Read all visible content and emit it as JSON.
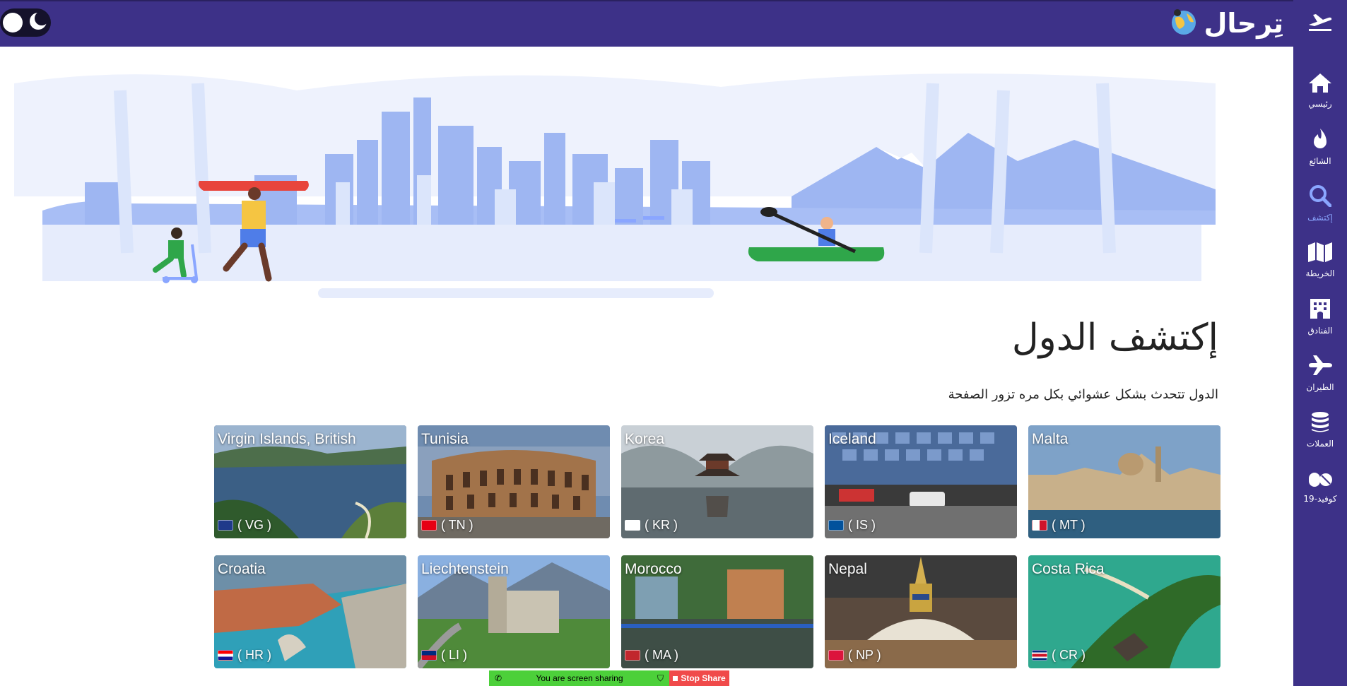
{
  "app": {
    "brand": "تِرحال"
  },
  "theme_toggle": {
    "state": "dark-mode toggle"
  },
  "sidebar": {
    "items": [
      {
        "label": "رئيسي",
        "icon": "home-icon"
      },
      {
        "label": "الشائع",
        "icon": "fire-icon"
      },
      {
        "label": "إكتشف",
        "icon": "search-icon",
        "active": true
      },
      {
        "label": "الخريطة",
        "icon": "map-icon"
      },
      {
        "label": "الفنادق",
        "icon": "hotel-icon"
      },
      {
        "label": "الطيران",
        "icon": "plane-icon"
      },
      {
        "label": "العملات",
        "icon": "coins-icon"
      },
      {
        "label": "كوفيد-19",
        "icon": "pills-icon"
      }
    ]
  },
  "main": {
    "title": "إكتشف الدول",
    "subtitle": "الدول تتحدث بشكل عشوائي بكل مره تزور الصفحة"
  },
  "countries": [
    {
      "name": "Virgin Islands, British",
      "code": "( VG )"
    },
    {
      "name": "Tunisia",
      "code": "( TN )"
    },
    {
      "name": "Korea",
      "code": "( KR )"
    },
    {
      "name": "Iceland",
      "code": "( IS )"
    },
    {
      "name": "Malta",
      "code": "( MT )"
    },
    {
      "name": "Croatia",
      "code": "( HR )"
    },
    {
      "name": "Liechtenstein",
      "code": "( LI )"
    },
    {
      "name": "Morocco",
      "code": "( MA )"
    },
    {
      "name": "Nepal",
      "code": "( NP )"
    },
    {
      "name": "Costa Rica",
      "code": "( CR )"
    }
  ],
  "screen_share": {
    "message": "You are screen sharing",
    "stop_label": "Stop Share"
  },
  "colors": {
    "header": "#3d3188",
    "accent": "#8aa6ff"
  }
}
